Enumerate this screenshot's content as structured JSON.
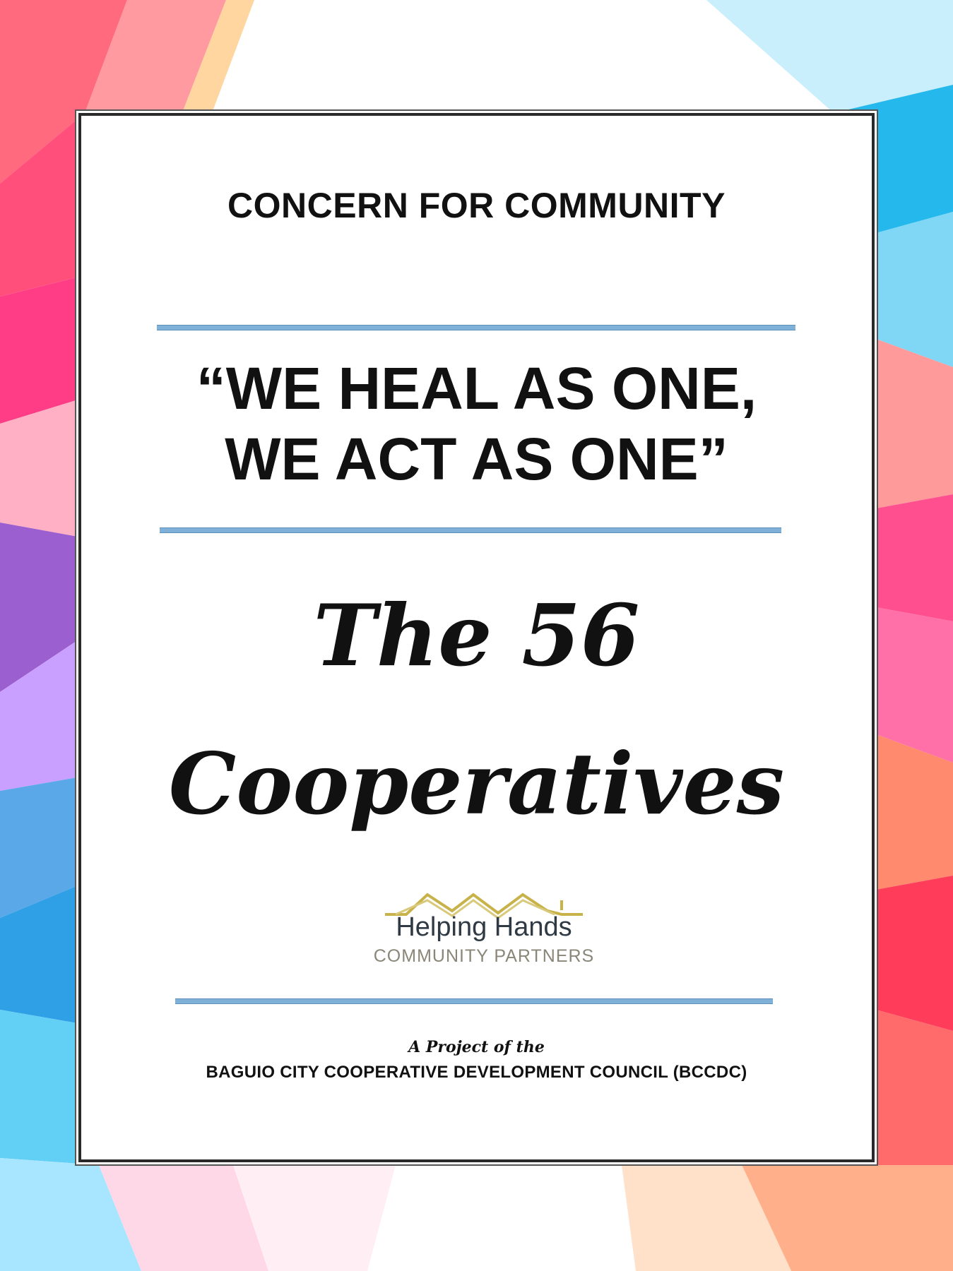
{
  "cover": {
    "heading": "CONCERN FOR COMMUNITY",
    "slogan_line1": "“WE HEAL AS ONE,",
    "slogan_line2": "WE ACT AS ONE”",
    "title_line1": "The 56",
    "title_line2": "Cooperatives",
    "project_of": "A Project of the",
    "organization": "BAGUIO CITY COOPERATIVE DEVELOPMENT COUNCIL (BCCDC)"
  },
  "logo": {
    "name": "Helping Hands",
    "subtitle": "COMMUNITY PARTNERS",
    "icon": "house-roofs-icon"
  },
  "colors": {
    "rule": "#7fb0d8",
    "frame": "#2a2a2a",
    "logo_roof": "#c8b24a"
  }
}
